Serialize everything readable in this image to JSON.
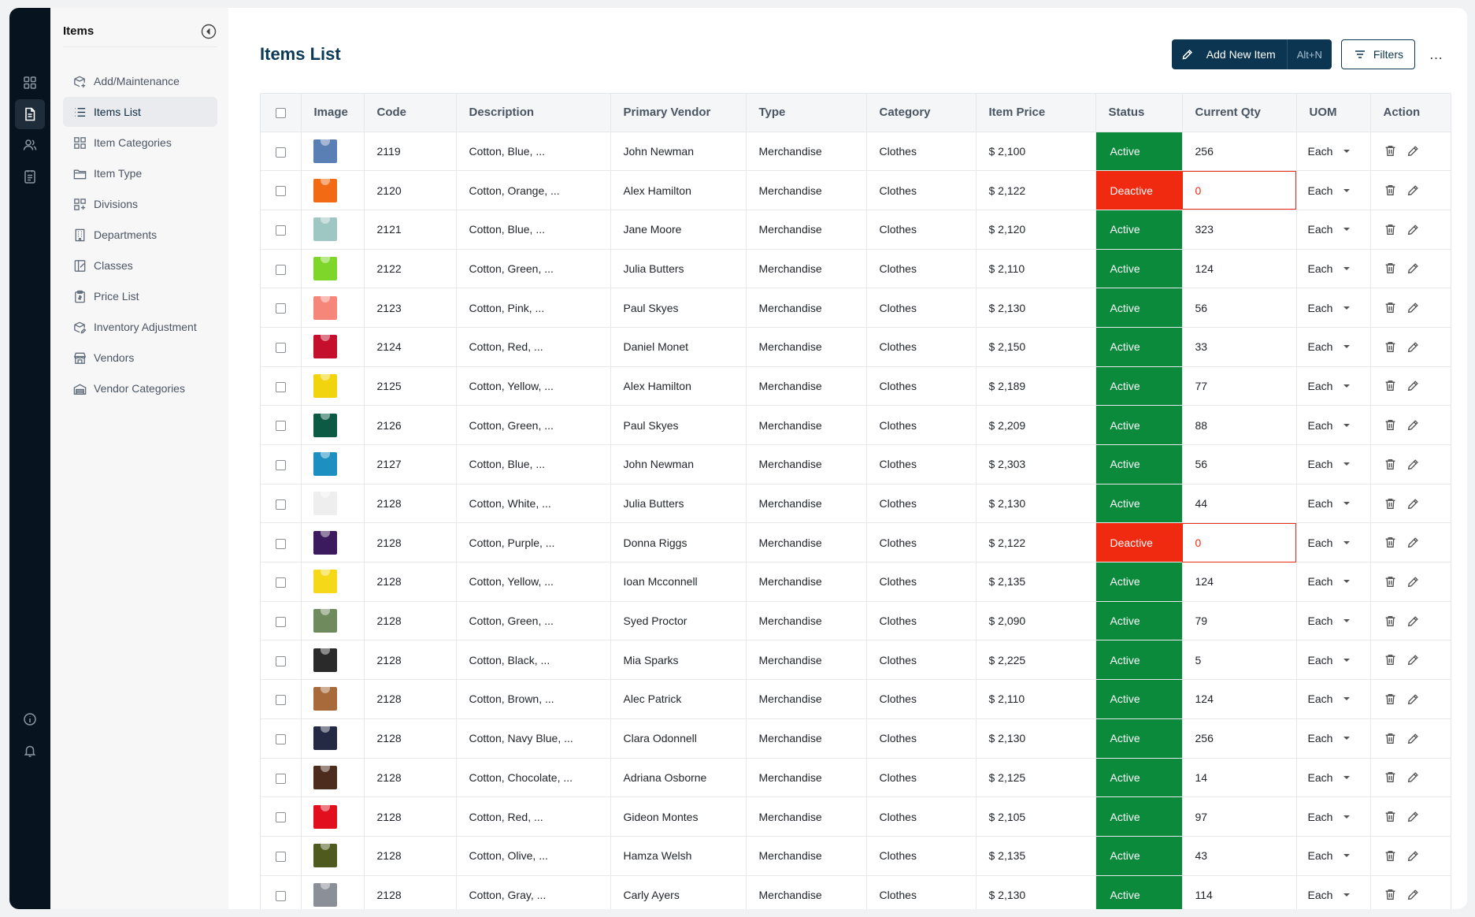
{
  "sidebar": {
    "title": "Items",
    "items": [
      {
        "label": "Add/Maintenance",
        "icon": "package-add-icon"
      },
      {
        "label": "Items List",
        "icon": "list-icon"
      },
      {
        "label": "Item Categories",
        "icon": "grid-icon"
      },
      {
        "label": "Item Type",
        "icon": "folder-icon"
      },
      {
        "label": "Divisions",
        "icon": "grid-plus-icon"
      },
      {
        "label": "Departments",
        "icon": "building-icon"
      },
      {
        "label": "Classes",
        "icon": "book-icon"
      },
      {
        "label": "Price List",
        "icon": "clipboard-icon"
      },
      {
        "label": "Inventory Adjustment",
        "icon": "package-edit-icon"
      },
      {
        "label": "Vendors",
        "icon": "store-icon"
      },
      {
        "label": "Vendor Categories",
        "icon": "warehouse-icon"
      }
    ]
  },
  "header": {
    "title": "Items List",
    "add_label": "Add New Item",
    "add_shortcut": "Alt+N",
    "filters_label": "Filters",
    "more_label": "…"
  },
  "table": {
    "columns": [
      "Image",
      "Code",
      "Description",
      "Primary Vendor",
      "Type",
      "Category",
      "Item Price",
      "Status",
      "Current Qty",
      "UOM",
      "Action"
    ],
    "rows": [
      {
        "color": "#5a7fb5",
        "code": "2119",
        "description": "Cotton, Blue, ...",
        "vendor": "John Newman",
        "type": "Merchandise",
        "category": "Clothes",
        "price": "$ 2,100",
        "status": "Active",
        "qty": "256",
        "uom": "Each"
      },
      {
        "color": "#f36a14",
        "code": "2120",
        "description": "Cotton, Orange, ...",
        "vendor": "Alex Hamilton",
        "type": "Merchandise",
        "category": "Clothes",
        "price": "$ 2,122",
        "status": "Deactive",
        "qty": "0",
        "uom": "Each"
      },
      {
        "color": "#9ec7c4",
        "code": "2121",
        "description": "Cotton, Blue, ...",
        "vendor": "Jane Moore",
        "type": "Merchandise",
        "category": "Clothes",
        "price": "$ 2,120",
        "status": "Active",
        "qty": "323",
        "uom": "Each"
      },
      {
        "color": "#7fd62a",
        "code": "2122",
        "description": "Cotton, Green, ...",
        "vendor": "Julia Butters",
        "type": "Merchandise",
        "category": "Clothes",
        "price": "$ 2,110",
        "status": "Active",
        "qty": "124",
        "uom": "Each"
      },
      {
        "color": "#f7867a",
        "code": "2123",
        "description": "Cotton, Pink, ...",
        "vendor": "Paul Skyes",
        "type": "Merchandise",
        "category": "Clothes",
        "price": "$ 2,130",
        "status": "Active",
        "qty": "56",
        "uom": "Each"
      },
      {
        "color": "#c4102c",
        "code": "2124",
        "description": "Cotton, Red, ...",
        "vendor": "Daniel Monet",
        "type": "Merchandise",
        "category": "Clothes",
        "price": "$ 2,150",
        "status": "Active",
        "qty": "33",
        "uom": "Each"
      },
      {
        "color": "#f2d40e",
        "code": "2125",
        "description": "Cotton, Yellow, ...",
        "vendor": "Alex Hamilton",
        "type": "Merchandise",
        "category": "Clothes",
        "price": "$ 2,189",
        "status": "Active",
        "qty": "77",
        "uom": "Each"
      },
      {
        "color": "#0c5a44",
        "code": "2126",
        "description": "Cotton, Green, ...",
        "vendor": "Paul Skyes",
        "type": "Merchandise",
        "category": "Clothes",
        "price": "$ 2,209",
        "status": "Active",
        "qty": "88",
        "uom": "Each"
      },
      {
        "color": "#1d8fc0",
        "code": "2127",
        "description": "Cotton, Blue, ...",
        "vendor": "John Newman",
        "type": "Merchandise",
        "category": "Clothes",
        "price": "$ 2,303",
        "status": "Active",
        "qty": "56",
        "uom": "Each"
      },
      {
        "color": "#eeeeee",
        "code": "2128",
        "description": "Cotton, White, ...",
        "vendor": "Julia Butters",
        "type": "Merchandise",
        "category": "Clothes",
        "price": "$ 2,130",
        "status": "Active",
        "qty": "44",
        "uom": "Each"
      },
      {
        "color": "#3b1a5e",
        "code": "2128",
        "description": "Cotton, Purple, ...",
        "vendor": "Donna Riggs",
        "type": "Merchandise",
        "category": "Clothes",
        "price": "$ 2,122",
        "status": "Deactive",
        "qty": "0",
        "uom": "Each"
      },
      {
        "color": "#f5d817",
        "code": "2128",
        "description": "Cotton, Yellow, ...",
        "vendor": "Ioan Mcconnell",
        "type": "Merchandise",
        "category": "Clothes",
        "price": "$ 2,135",
        "status": "Active",
        "qty": "124",
        "uom": "Each"
      },
      {
        "color": "#6f8a5c",
        "code": "2128",
        "description": "Cotton, Green, ...",
        "vendor": "Syed Proctor",
        "type": "Merchandise",
        "category": "Clothes",
        "price": "$ 2,090",
        "status": "Active",
        "qty": "79",
        "uom": "Each"
      },
      {
        "color": "#2a2a2a",
        "code": "2128",
        "description": "Cotton, Black, ...",
        "vendor": "Mia Sparks",
        "type": "Merchandise",
        "category": "Clothes",
        "price": "$ 2,225",
        "status": "Active",
        "qty": "5",
        "uom": "Each"
      },
      {
        "color": "#a86a3a",
        "code": "2128",
        "description": "Cotton, Brown, ...",
        "vendor": "Alec Patrick",
        "type": "Merchandise",
        "category": "Clothes",
        "price": "$ 2,110",
        "status": "Active",
        "qty": "124",
        "uom": "Each"
      },
      {
        "color": "#252a44",
        "code": "2128",
        "description": "Cotton, Navy Blue, ...",
        "vendor": "Clara Odonnell",
        "type": "Merchandise",
        "category": "Clothes",
        "price": "$ 2,130",
        "status": "Active",
        "qty": "256",
        "uom": "Each"
      },
      {
        "color": "#4c2c1c",
        "code": "2128",
        "description": "Cotton, Chocolate, ...",
        "vendor": "Adriana Osborne",
        "type": "Merchandise",
        "category": "Clothes",
        "price": "$ 2,125",
        "status": "Active",
        "qty": "14",
        "uom": "Each"
      },
      {
        "color": "#e2101e",
        "code": "2128",
        "description": "Cotton, Red, ...",
        "vendor": "Gideon Montes",
        "type": "Merchandise",
        "category": "Clothes",
        "price": "$ 2,105",
        "status": "Active",
        "qty": "97",
        "uom": "Each"
      },
      {
        "color": "#4f5a1e",
        "code": "2128",
        "description": "Cotton, Olive, ...",
        "vendor": "Hamza Welsh",
        "type": "Merchandise",
        "category": "Clothes",
        "price": "$ 2,135",
        "status": "Active",
        "qty": "43",
        "uom": "Each"
      },
      {
        "color": "#8a8f98",
        "code": "2128",
        "description": "Cotton, Gray, ...",
        "vendor": "Carly Ayers",
        "type": "Merchandise",
        "category": "Clothes",
        "price": "$ 2,130",
        "status": "Active",
        "qty": "114",
        "uom": "Each"
      }
    ]
  },
  "colors": {
    "active": "#0b8a3c",
    "deactive": "#f02a10",
    "brand": "#0b3550"
  }
}
